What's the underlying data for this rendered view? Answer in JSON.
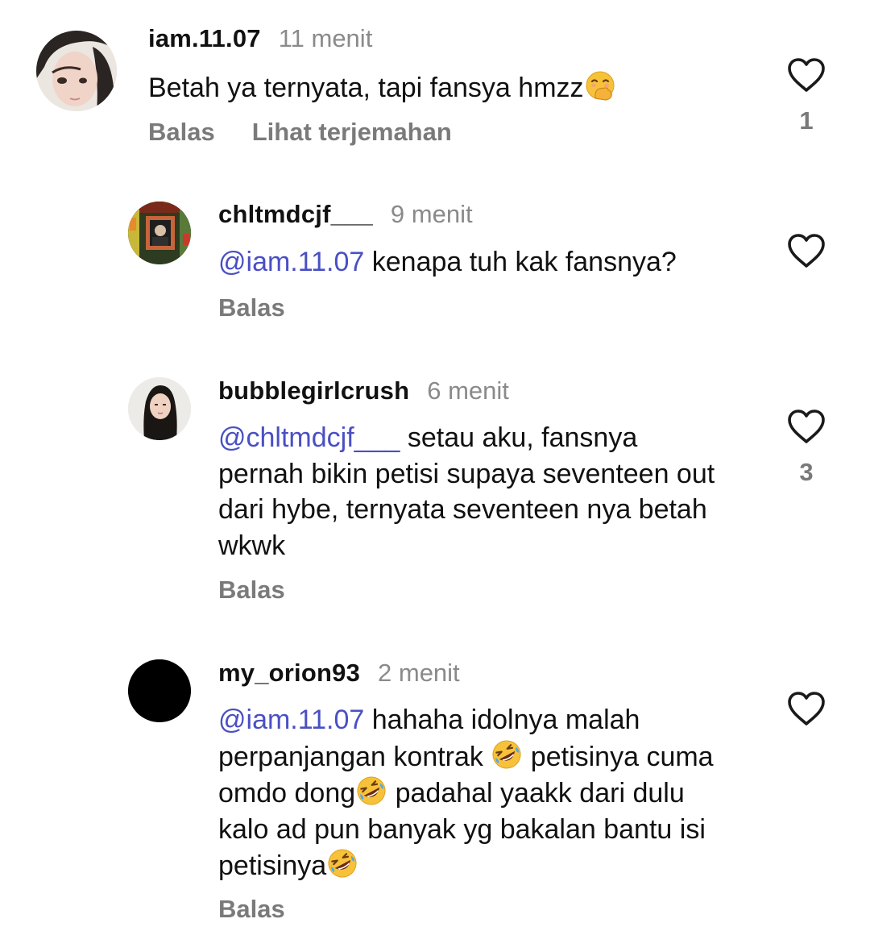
{
  "comments": [
    {
      "username": "iam.11.07",
      "time": "11 menit",
      "mention": "",
      "text_before_emoji": "Betah ya ternyata, tapi fansya hmzz",
      "emoji": "hand-over-mouth-emoji",
      "reply_label": "Balas",
      "translate_label": "Lihat terjemahan",
      "like_count": "1"
    },
    {
      "username": "chltmdcjf___",
      "time": "9 menit",
      "mention": "@iam.11.07",
      "text": " kenapa tuh kak fansnya?",
      "reply_label": "Balas",
      "like_count": ""
    },
    {
      "username": "bubblegirlcrush",
      "time": "6 menit",
      "mention": "@chltmdcjf___",
      "text": " setau aku, fansnya pernah bikin petisi supaya seventeen out dari hybe, ternyata seventeen nya betah wkwk",
      "reply_label": "Balas",
      "like_count": "3"
    },
    {
      "username": "my_orion93",
      "time": "2 menit",
      "mention": "@iam.11.07",
      "text_part1": " hahaha idolnya malah perpanjangan kontrak ",
      "text_part2": " petisinya cuma omdo dong",
      "text_part3": " padahal yaakk dari dulu kalo ad pun banyak yg bakalan bantu isi petisinya",
      "emoji": "rolling-on-floor-laughing-emoji",
      "reply_label": "Balas",
      "like_count": ""
    }
  ],
  "colors": {
    "mention": "#4a4fc4",
    "secondary_text": "#7a7a7a",
    "time_text": "#8a8a8a",
    "primary_text": "#111111"
  }
}
